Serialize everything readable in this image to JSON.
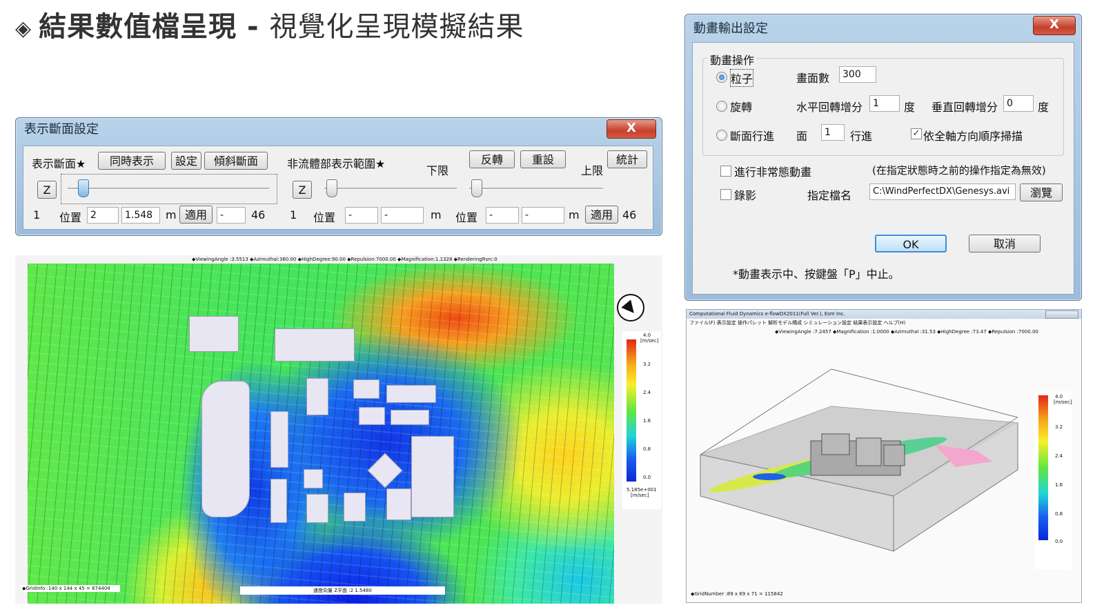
{
  "title": {
    "main": "結果數值檔呈現",
    "separator": "-",
    "subtitle": "視覺化呈現模擬結果"
  },
  "section_window": {
    "title": "表示斷面設定",
    "close": "X",
    "display_section_label": "表示斷面★",
    "simultaneous_button": "同時表示",
    "settings_button": "設定",
    "tilt_button": "傾斜斷面",
    "nonfluid_label": "非流體部表示範圍★",
    "lower_label": "下限",
    "upper_label": "上限",
    "invert_button": "反轉",
    "reset_button": "重設",
    "stats_button": "統計",
    "z_button_left": "Z",
    "z_button_right": "Z",
    "left_min": "1",
    "left_position_label": "位置",
    "left_position_index": "2",
    "left_position_value": "1.548",
    "unit_m": "m",
    "apply_button": "適用",
    "left_dash": "-",
    "left_max": "46",
    "right_min": "1",
    "right_position_label": "位置",
    "right_low_a": "-",
    "right_low_b": "-",
    "right_position_label_2": "位置",
    "right_high_a": "-",
    "right_high_b": "-",
    "right_max": "46",
    "slider_left_fraction": 0.03,
    "slider_low_fraction": 0.0,
    "slider_high_fraction": 0.0
  },
  "plan_view": {
    "header": "◆ViewingAngle :3.5513  ◆Azimuthal:360.00  ◆HighDegree:90.00  ◆Repulsion:7000.00  ◆Magnification:1.1328  ◆RenderingRsrc:0",
    "footer_left": "◆GridInfo :140 x 144 x 45 = 874404",
    "footer_center": "速度向量 Z平面 :2  1.5480",
    "legend_unit": "[m/sec]",
    "legend_ticks": [
      "4.0",
      "3.2",
      "2.4",
      "1.6",
      "0.8",
      "0.0"
    ],
    "legend_footer": "5.185e+001",
    "legend_footer_unit": "[m/sec]",
    "colors": {
      "low": "#1034e0",
      "mid": "#3ee86a",
      "high": "#f03a10"
    }
  },
  "anim_dialog": {
    "title": "動畫輸出設定",
    "close": "X",
    "group_label": "動畫操作",
    "opt_particle": "粒子",
    "opt_rotate": "旋轉",
    "opt_section": "斷面行進",
    "frames_label": "畫面數",
    "frames_value": "300",
    "h_rot_label": "水平回轉增分",
    "h_rot_value": "1",
    "deg_1": "度",
    "v_rot_label": "垂直回轉增分",
    "v_rot_value": "0",
    "deg_2": "度",
    "face_label": "面",
    "face_value": "1",
    "advance_label": "行進",
    "scan_label": "依全軸方向順序掃描",
    "nonsteady_label": "進行非常態動畫",
    "nonsteady_note": "(在指定狀態時之前的操作指定為無效)",
    "record_label": "錄影",
    "filename_label": "指定檔名",
    "filename_value": "C:\\WindPerfectDX\\Genesys.avi",
    "browse_button": "瀏覽",
    "ok_button": "OK",
    "cancel_button": "取消",
    "note": "*動畫表示中、按鍵盤「P」中止。"
  },
  "cfd_window": {
    "title": "Computational Fluid Dynamics  e-flowDX2011(Full Ver.), Esm Inc.",
    "menu": "ファイル(F)  表示設定  操作パレット  解析モデル構成  シミュレーション設定  結果表示設定  ヘルプ(H)",
    "header": "◆ViewingAngle :7.2457  ◆Magnification :1.0000  ◆Azimuthal :31.53  ◆HighDegree :73.47  ◆Repulsion :7000.00",
    "footer": "◆GridNumber :89 x 69 x 71 = 115842",
    "legend_unit": "[m/sec]",
    "legend_ticks": [
      "4.0",
      "3.2",
      "2.4",
      "1.6",
      "0.8",
      "0.0"
    ]
  }
}
